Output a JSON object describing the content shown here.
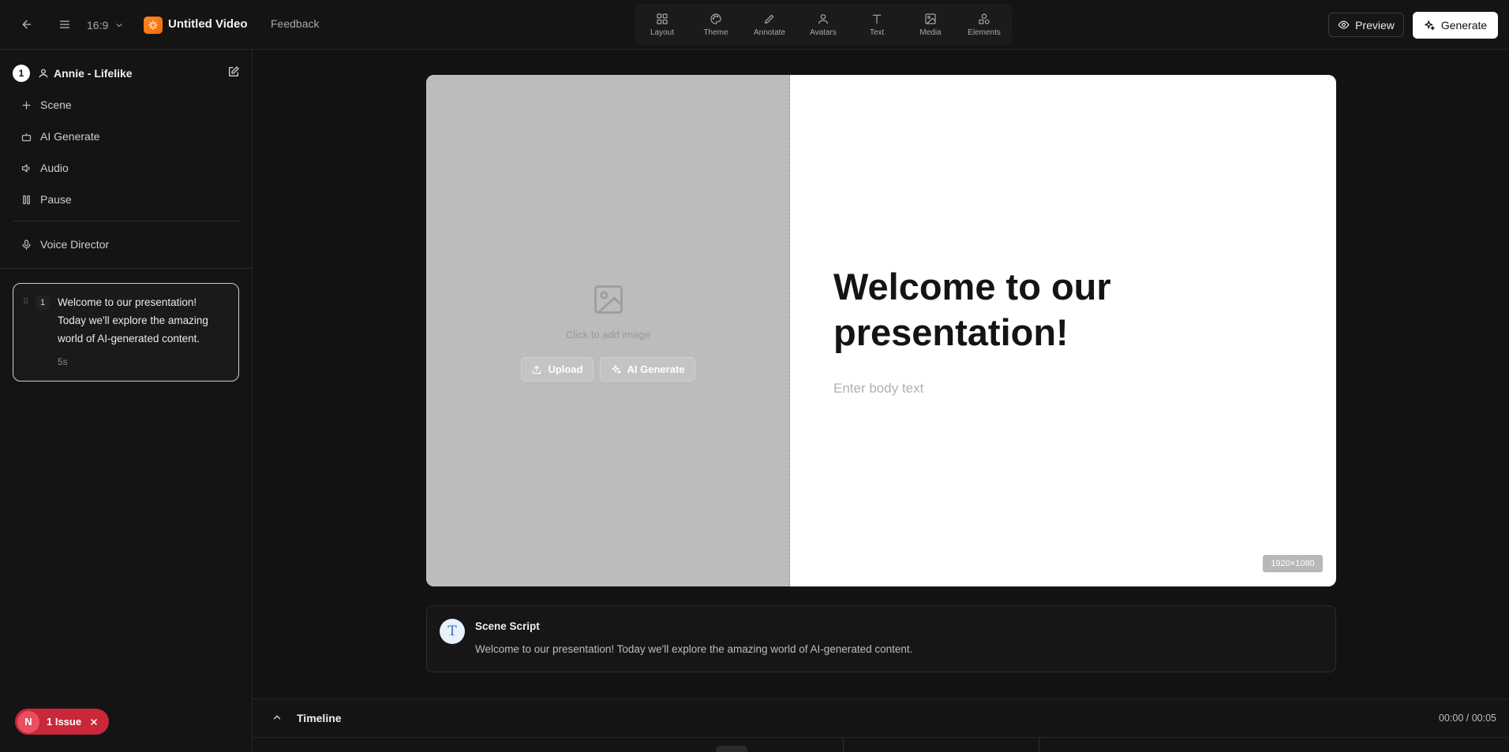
{
  "header": {
    "aspect_ratio": "16:9",
    "project_title": "Untitled Video",
    "feedback_label": "Feedback",
    "preview_label": "Preview",
    "generate_label": "Generate",
    "brand_color": "#f97316"
  },
  "toolbar": {
    "tools": [
      {
        "label": "Layout",
        "icon": "layout-grid-icon"
      },
      {
        "label": "Theme",
        "icon": "palette-icon"
      },
      {
        "label": "Annotate",
        "icon": "pencil-icon"
      },
      {
        "label": "Avatars",
        "icon": "user-icon"
      },
      {
        "label": "Text",
        "icon": "type-icon"
      },
      {
        "label": "Media",
        "icon": "image-icon"
      },
      {
        "label": "Elements",
        "icon": "shapes-icon"
      }
    ]
  },
  "sidebar": {
    "avatar_number": "1",
    "avatar_name": "Annie - Lifelike",
    "items": [
      {
        "label": "Scene",
        "icon": "plus-icon"
      },
      {
        "label": "AI Generate",
        "icon": "bot-icon"
      },
      {
        "label": "Audio",
        "icon": "speaker-icon"
      },
      {
        "label": "Pause",
        "icon": "pause-icon"
      }
    ],
    "voice_director_label": "Voice Director",
    "scene_card": {
      "number": "1",
      "text": "Welcome to our presentation! Today we'll explore the amazing world of AI-generated content.",
      "duration": "5s"
    }
  },
  "issues": {
    "initial": "N",
    "label": "1 Issue"
  },
  "slide": {
    "image_hint": "Click to add image",
    "upload_label": "Upload",
    "ai_generate_label": "AI Generate",
    "title": "Welcome to our presentation!",
    "body_placeholder": "Enter body text",
    "resolution": "1920×1080"
  },
  "script": {
    "icon_letter": "T",
    "title": "Scene Script",
    "text": "Welcome to our presentation! Today we'll explore the amazing world of AI-generated content."
  },
  "timeline": {
    "label": "Timeline",
    "time": "00:00 / 00:05"
  }
}
